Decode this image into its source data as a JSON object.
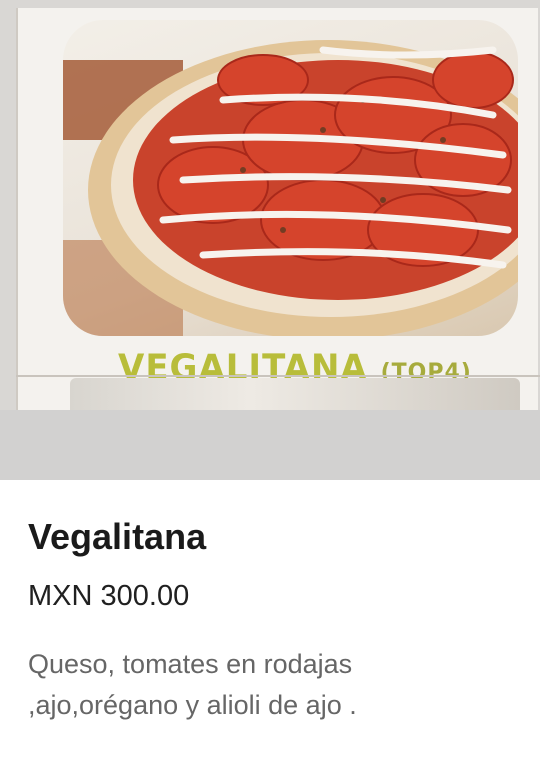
{
  "product": {
    "image_caption": "VEGALITANA",
    "image_caption_suffix": "(TOP4)",
    "name": "Vegalitana",
    "price": "MXN 300.00",
    "description": "Queso, tomates en rodajas ,ajo,orégano y alioli de ajo ."
  },
  "colors": {
    "caption_green": "#b8bd3a",
    "price_text": "#202020",
    "description_text": "#666666"
  }
}
